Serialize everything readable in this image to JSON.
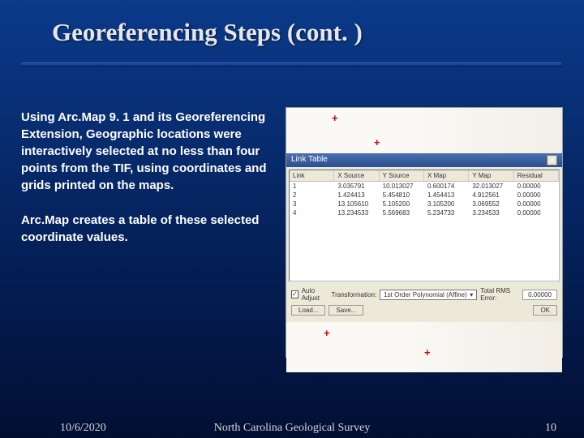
{
  "title": "Georeferencing Steps (cont. )",
  "body": {
    "p1": "Using Arc.Map 9. 1 and its Georeferencing Extension, Geographic locations were interactively selected at no less than four points from the TIF, using coordinates and grids printed on the maps.",
    "p2": "Arc.Map creates a table of these selected coordinate values."
  },
  "link_table": {
    "title": "Link Table",
    "headers": [
      "Link",
      "X Source",
      "Y Source",
      "X Map",
      "Y Map",
      "Residual"
    ],
    "rows": [
      [
        "1",
        "3.035791",
        "10.013027",
        "0.600174",
        "32.013027",
        "0.00000"
      ],
      [
        "2",
        "1.424413",
        "5.454810",
        "1.454413",
        "4.912561",
        "0.00000"
      ],
      [
        "3",
        "13.105610",
        "5.105200",
        "3.105200",
        "3.069552",
        "0.00000"
      ],
      [
        "4",
        "13.234533",
        "5.569683",
        "5.234733",
        "3.234533",
        "0.00000"
      ]
    ],
    "auto_adjust": "Auto Adjust",
    "transform_label": "Transformation:",
    "transform_value": "1st Order Polynomial (Affine)",
    "rms_label": "Total RMS Error:",
    "rms_value": "0.00000",
    "load": "Load...",
    "save": "Save...",
    "ok": "OK"
  },
  "footer": {
    "date": "10/6/2020",
    "org": "North Carolina Geological Survey",
    "page": "10"
  }
}
